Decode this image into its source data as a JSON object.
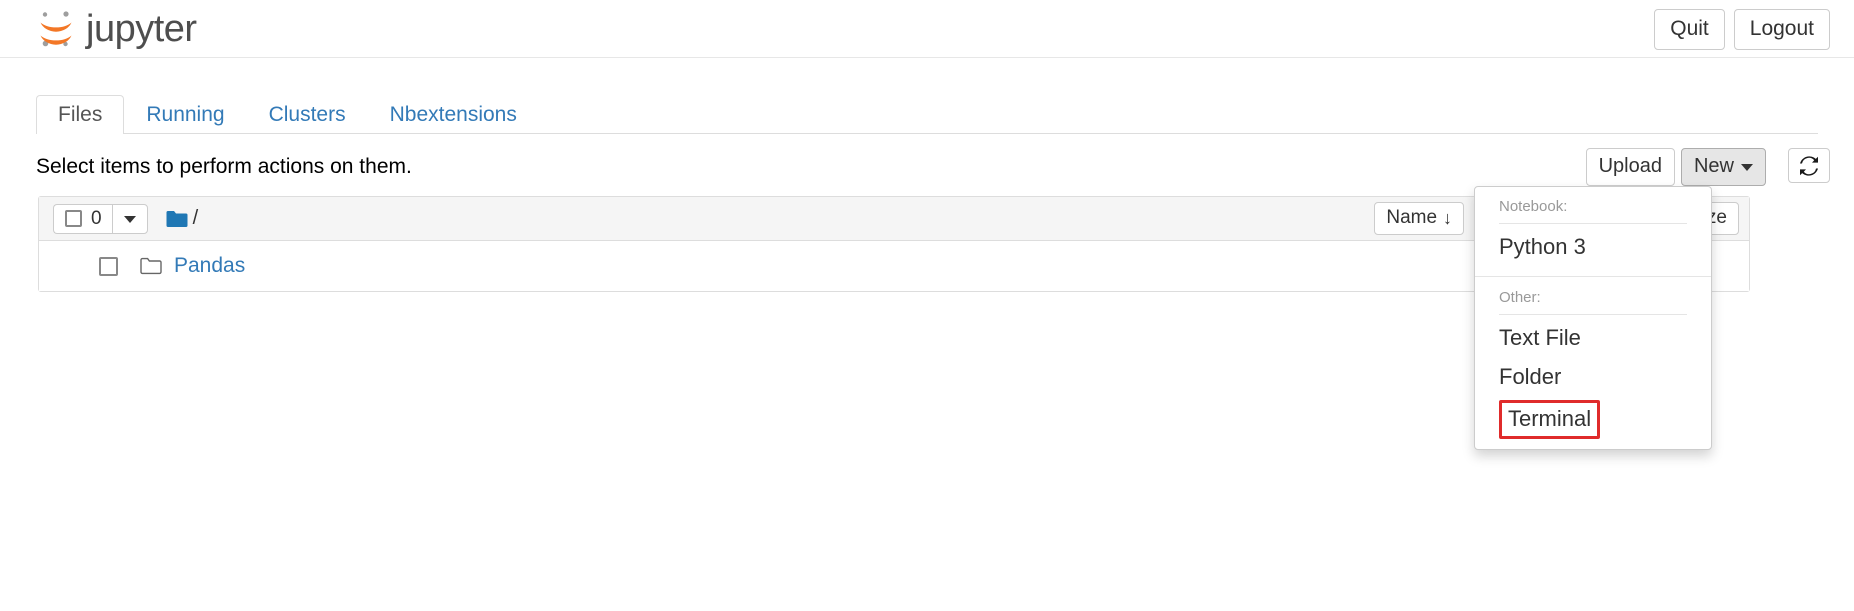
{
  "header": {
    "brand_text": "jupyter",
    "logo_icon": "jupyter-logo-icon",
    "quit_label": "Quit",
    "logout_label": "Logout"
  },
  "tabs": [
    {
      "label": "Files",
      "active": true
    },
    {
      "label": "Running",
      "active": false
    },
    {
      "label": "Clusters",
      "active": false
    },
    {
      "label": "Nbextensions",
      "active": false
    }
  ],
  "toolbar": {
    "notice": "Select items to perform actions on them.",
    "upload_label": "Upload",
    "new_label": "New",
    "new_caret_icon": "caret-down-icon",
    "refresh_icon": "refresh-icon"
  },
  "new_menu": {
    "notebook_header": "Notebook:",
    "notebook_items": [
      "Python 3"
    ],
    "other_header": "Other:",
    "other_items": [
      "Text File",
      "Folder",
      "Terminal"
    ],
    "highlighted_item": "Terminal",
    "highlight_color": "#e02b2b"
  },
  "filelist": {
    "select_count": "0",
    "select_caret_icon": "caret-down-icon",
    "breadcrumb_folder_icon": "folder-filled-icon",
    "breadcrumb_path": "/",
    "sort_name_label": "Name",
    "sort_name_arrow": "↓",
    "sort_size_label": "Size",
    "rows": [
      {
        "name": "Pandas",
        "icon": "folder-outline-icon",
        "checkbox": "unchecked"
      }
    ]
  },
  "colors": {
    "link": "#337ab7",
    "logo_orange": "#f37726",
    "logo_gray": "#9e9e9e",
    "folder_blue": "#1f77b4"
  }
}
